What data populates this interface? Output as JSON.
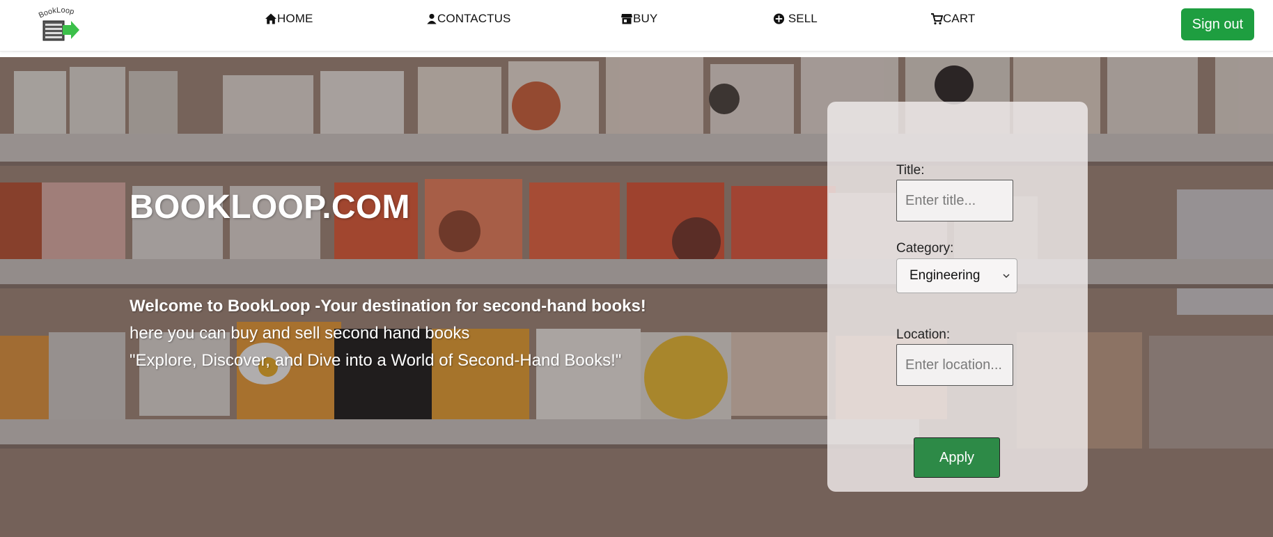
{
  "brand": {
    "logo_text": "BookLoop",
    "accent": "#1e9e40"
  },
  "nav": {
    "items": [
      {
        "label": "HOME",
        "icon": "home-icon"
      },
      {
        "label": "CONTACTUS",
        "icon": "user-icon"
      },
      {
        "label": "BUY",
        "icon": "store-icon"
      },
      {
        "label": " SELL",
        "icon": "plus-circle-icon"
      },
      {
        "label": "CART",
        "icon": "cart-icon"
      }
    ],
    "signout_label": "Sign out"
  },
  "hero": {
    "title": "BOOKLOOP.COM",
    "welcome": "Welcome to BookLoop -Your destination for second-hand books!",
    "line2": "here you can buy and sell second hand books",
    "line3": "\"Explore, Discover, and Dive into a World of Second-Hand Books!\""
  },
  "filter": {
    "title_label": "Title:",
    "title_placeholder": "Enter title...",
    "category_label": "Category:",
    "category_value": "Engineering",
    "location_label": "Location:",
    "location_placeholder": "Enter location...",
    "apply_label": "Apply",
    "apply_color": "#2d8a47"
  }
}
